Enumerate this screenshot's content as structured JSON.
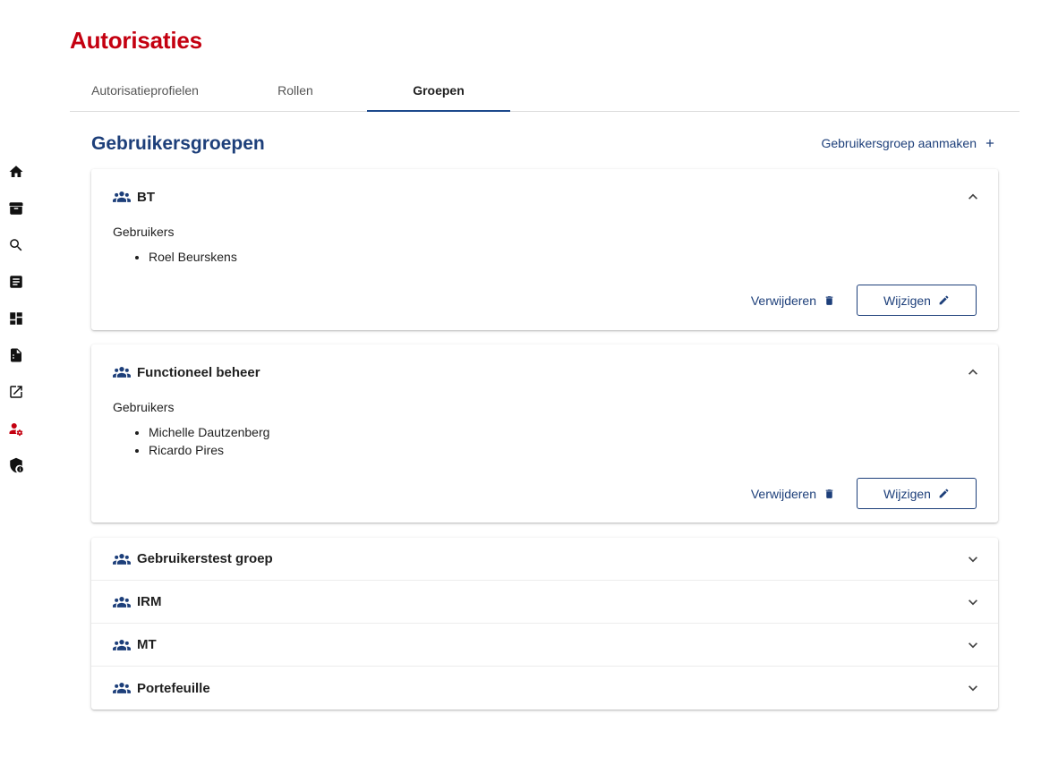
{
  "page": {
    "title": "Autorisaties"
  },
  "sidebar": {
    "items": [
      {
        "icon": "home-icon"
      },
      {
        "icon": "archive-icon"
      },
      {
        "icon": "search-icon"
      },
      {
        "icon": "document-icon"
      },
      {
        "icon": "dashboard-icon"
      },
      {
        "icon": "report-icon"
      },
      {
        "icon": "external-link-icon"
      },
      {
        "icon": "user-settings-icon",
        "active": true
      },
      {
        "icon": "shield-icon"
      }
    ],
    "active_color": "#c40010"
  },
  "tabs": [
    {
      "label": "Autorisatieprofielen",
      "active": false
    },
    {
      "label": "Rollen",
      "active": false
    },
    {
      "label": "Groepen",
      "active": true
    }
  ],
  "section": {
    "title": "Gebruikersgroepen",
    "create_label": "Gebruikersgroep aanmaken"
  },
  "expanded_groups": [
    {
      "name": "BT",
      "users_label": "Gebruikers",
      "users": [
        "Roel Beurskens"
      ],
      "delete_label": "Verwijderen",
      "edit_label": "Wijzigen"
    },
    {
      "name": "Functioneel beheer",
      "users_label": "Gebruikers",
      "users": [
        "Michelle Dautzenberg",
        "Ricardo Pires"
      ],
      "delete_label": "Verwijderen",
      "edit_label": "Wijzigen"
    }
  ],
  "collapsed_groups": [
    {
      "name": "Gebruikerstest groep"
    },
    {
      "name": "IRM"
    },
    {
      "name": "MT"
    },
    {
      "name": "Portefeuille"
    }
  ],
  "colors": {
    "brand_red": "#c40010",
    "primary_blue": "#1d3f7a"
  }
}
